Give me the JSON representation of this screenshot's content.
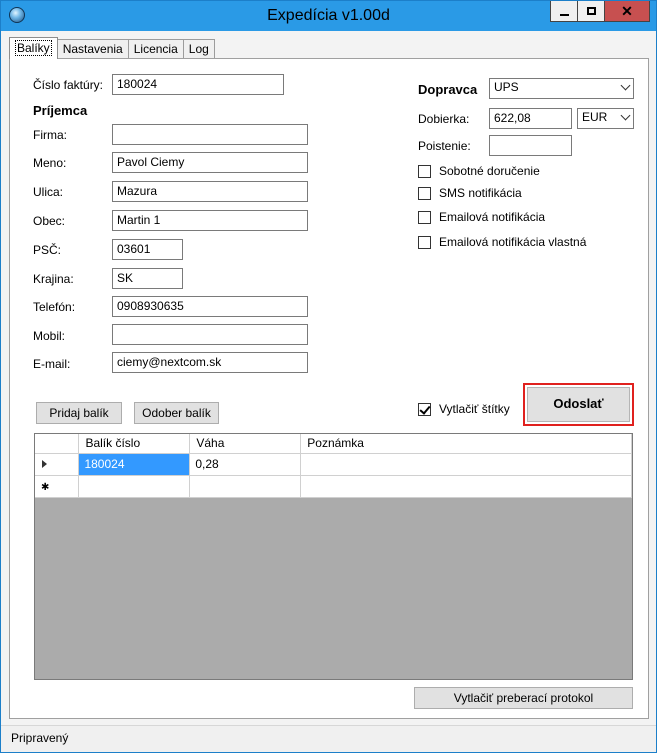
{
  "window": {
    "title": "Expedícia v1.00d"
  },
  "tabs": [
    {
      "label": "Balíky"
    },
    {
      "label": "Nastavenia"
    },
    {
      "label": "Licencia"
    },
    {
      "label": "Log"
    }
  ],
  "invoice": {
    "label": "Číslo faktúry:",
    "value": "180024"
  },
  "recipient": {
    "heading": "Príjemca",
    "firma": {
      "label": "Firma:",
      "value": ""
    },
    "meno": {
      "label": "Meno:",
      "value": "Pavol Ciemy"
    },
    "ulica": {
      "label": "Ulica:",
      "value": "Mazura"
    },
    "obec": {
      "label": "Obec:",
      "value": "Martin 1"
    },
    "psc": {
      "label": "PSČ:",
      "value": "03601"
    },
    "krajina": {
      "label": "Krajina:",
      "value": "SK"
    },
    "telefon": {
      "label": "Telefón:",
      "value": "0908930635"
    },
    "mobil": {
      "label": "Mobil:",
      "value": ""
    },
    "email": {
      "label": "E-mail:",
      "value": "ciemy@nextcom.sk"
    }
  },
  "carrier": {
    "label": "Dopravca",
    "selected": "UPS",
    "cod_label": "Dobierka:",
    "cod_value": "622,08",
    "currency": "EUR",
    "insurance_label": "Poistenie:",
    "insurance_value": ""
  },
  "options": [
    {
      "label": "Sobotné doručenie",
      "checked": false
    },
    {
      "label": "SMS notifikácia",
      "checked": false
    },
    {
      "label": "Emailová notifikácia",
      "checked": false
    },
    {
      "label": "Emailová notifikácia vlastná",
      "checked": false
    }
  ],
  "buttons": {
    "add_package": "Pridaj balík",
    "remove_package": "Odober balík",
    "print_labels": "Vytlačiť štítky",
    "send": "Odoslať",
    "print_protocol": "Vytlačiť preberací protokol"
  },
  "print_labels_checked": true,
  "grid": {
    "columns": [
      "Balík číslo",
      "Váha",
      "Poznámka"
    ],
    "rows": [
      {
        "cislo": "180024",
        "vaha": "0,28",
        "poznamka": ""
      }
    ]
  },
  "status": {
    "text": "Pripravený"
  }
}
